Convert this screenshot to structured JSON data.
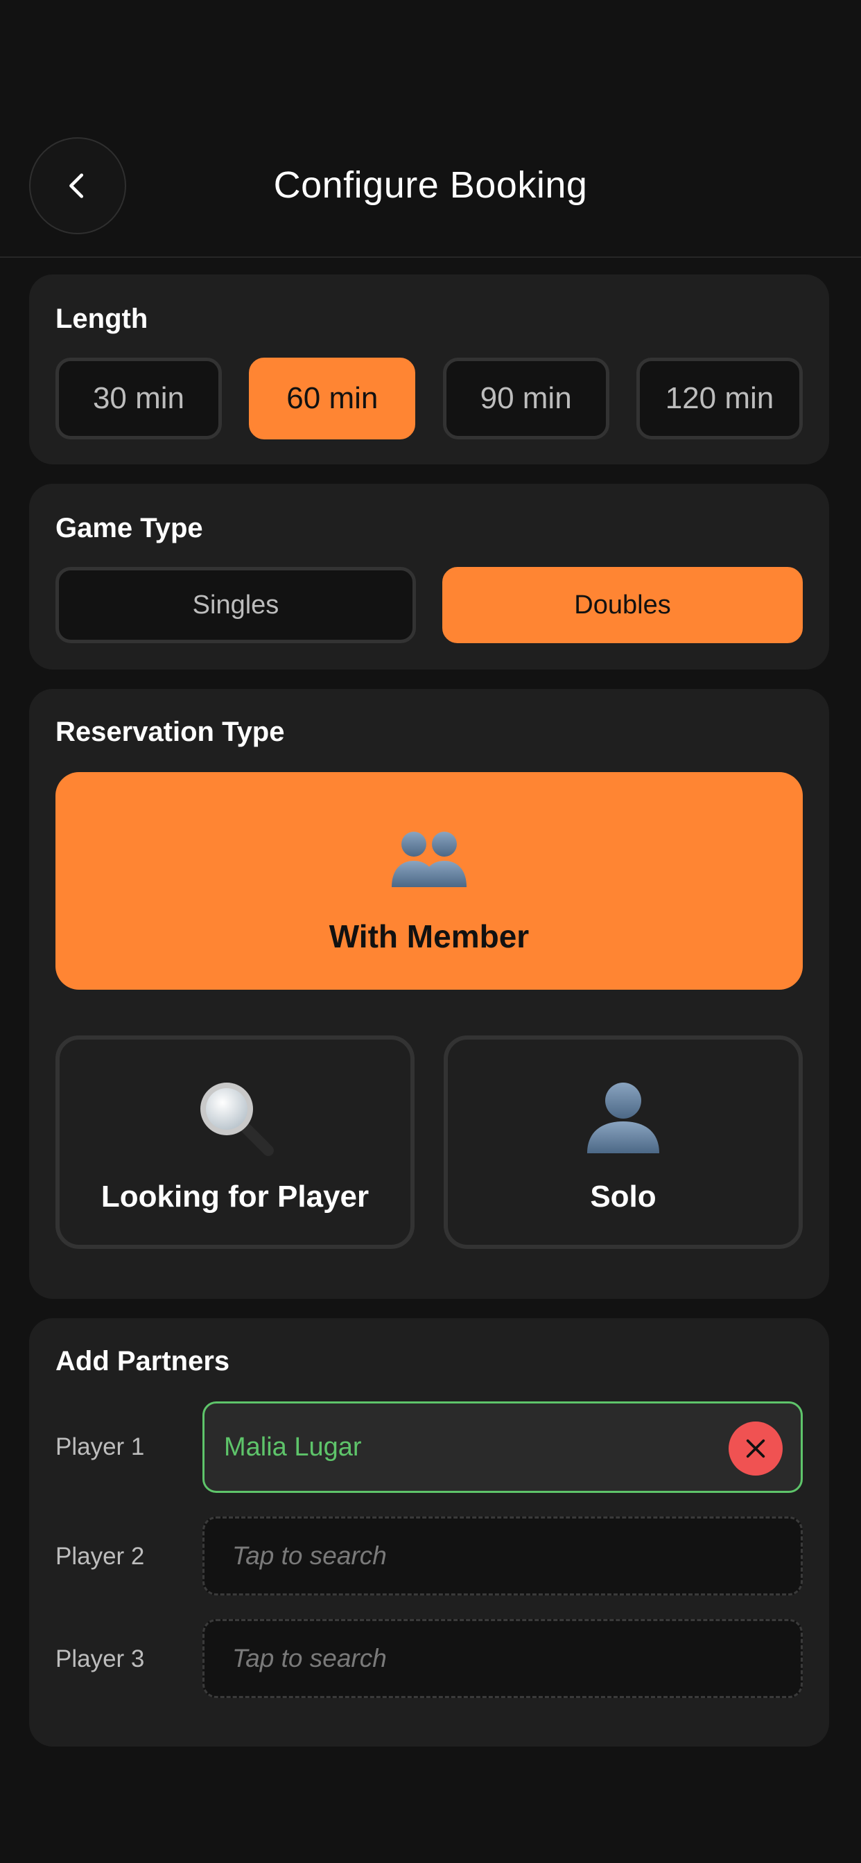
{
  "header": {
    "title": "Configure Booking"
  },
  "length": {
    "title": "Length",
    "options": [
      "30 min",
      "60 min",
      "90 min",
      "120 min"
    ],
    "selected": "60 min"
  },
  "game_type": {
    "title": "Game Type",
    "options": [
      "Singles",
      "Doubles"
    ],
    "selected": "Doubles"
  },
  "reservation": {
    "title": "Reservation Type",
    "with_member": {
      "label": "With Member",
      "icon": "two-people-icon"
    },
    "looking": {
      "label": "Looking for Player",
      "icon": "magnifier-icon"
    },
    "solo": {
      "label": "Solo",
      "icon": "person-icon"
    },
    "selected": "With Member"
  },
  "partners": {
    "title": "Add Partners",
    "players": [
      {
        "label": "Player 1",
        "value": "Malia Lugar",
        "placeholder": ""
      },
      {
        "label": "Player 2",
        "value": "",
        "placeholder": "Tap to search"
      },
      {
        "label": "Player 3",
        "value": "",
        "placeholder": "Tap to search"
      }
    ]
  },
  "colors": {
    "background": "#121212",
    "card": "#1f1f1f",
    "accent": "#ff8533",
    "success": "#5ec46a",
    "danger": "#f05252"
  }
}
